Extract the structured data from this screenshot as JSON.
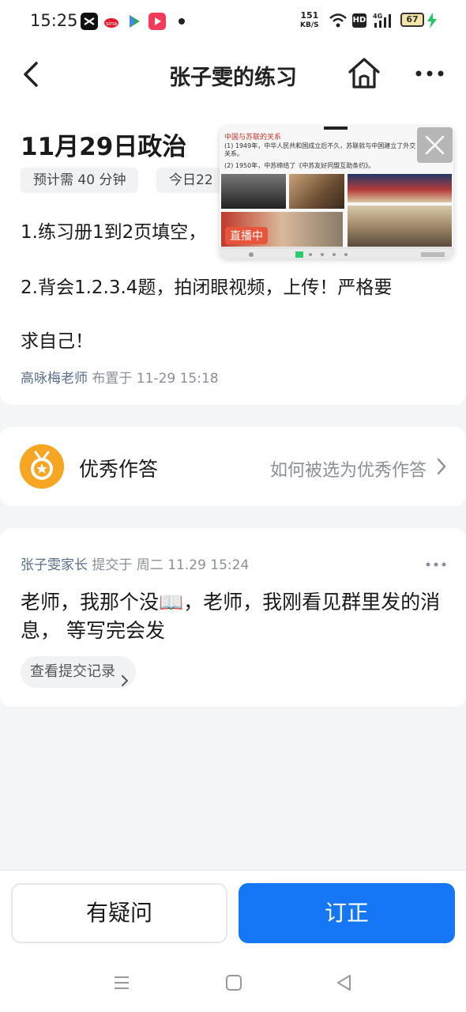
{
  "status_bar": {
    "time": "15:25",
    "net_speed_value": "151",
    "net_speed_unit": "KB/S",
    "hd_label": "HD",
    "signal_label": "4G",
    "battery_level": "67",
    "app_icons": [
      "capcut-icon",
      "sina-icon",
      "play-store-icon",
      "video-app-icon"
    ]
  },
  "nav": {
    "title": "张子雯的练习"
  },
  "task": {
    "title": "11月29日政治",
    "chip_duration": "预计需 40 分钟",
    "chip_count": "今日22",
    "line1": "1.练习册1到2页填空，",
    "line2": "2.背会1.2.3.4题，拍闭眼视频，上传！严格要",
    "line3": "求自己！",
    "teacher": "高咏梅老师",
    "assigned_at": "布置于 11-29 15:18"
  },
  "live_window": {
    "heading": "中国与苏联的关系",
    "point1": "(1) 1949年，中华人民共和国成立后不久，苏联就与中国建立了外交关系。",
    "point2": "(2) 1950年，中苏缔结了《中苏友好同盟互助条约》。",
    "badge": "直播中"
  },
  "excellent": {
    "label": "优秀作答",
    "link": "如何被选为优秀作答"
  },
  "submission": {
    "parent": "张子雯家长",
    "submitted_at": "提交于  周二 11.29 15:24",
    "text": "老师，我那个没📖，老师，我刚看见群里发的消息， 等写完会发",
    "history_label": "查看提交记录"
  },
  "actions": {
    "question_label": "有疑问",
    "correct_label": "订正"
  },
  "colors": {
    "primary": "#1677f6",
    "medal": "#f6a623",
    "live_badge": "#e8553b"
  }
}
